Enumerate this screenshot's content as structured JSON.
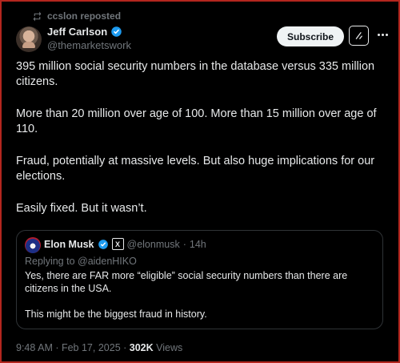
{
  "repost": {
    "label": "ccslon reposted",
    "icon": "repost-icon"
  },
  "author": {
    "name": "Jeff Carlson",
    "handle": "@themarketswork",
    "verified_color": "#1d9bf0"
  },
  "actions": {
    "subscribe_label": "Subscribe",
    "grok_icon": "grok-icon",
    "more_icon": "more-icon"
  },
  "post": {
    "paragraphs": [
      "395 million social security numbers in the database versus 335 million citizens.",
      "More than 20 million over age of 100. More than 15 million over age of 110.",
      "Fraud, potentially at massive levels. But also huge implications for our elections.",
      "Easily fixed. But it wasn’t."
    ]
  },
  "quote": {
    "name": "Elon Musk",
    "handle": "@elonmusk",
    "dot": "·",
    "time": "14h",
    "replying_to": "Replying to @aidenHIKO",
    "paragraphs": [
      "Yes, there are FAR more “eligible” social security numbers than there are citizens in the USA.",
      "This might be the biggest fraud in history."
    ]
  },
  "footer": {
    "timestamp": "9:48 AM · Feb 17, 2025 · ",
    "views_count": "302K",
    "views_label": " Views"
  },
  "colors": {
    "background": "#000000",
    "text": "#e7e9ea",
    "muted": "#71767b",
    "accent": "#1d9bf0",
    "border": "#2f3336"
  }
}
